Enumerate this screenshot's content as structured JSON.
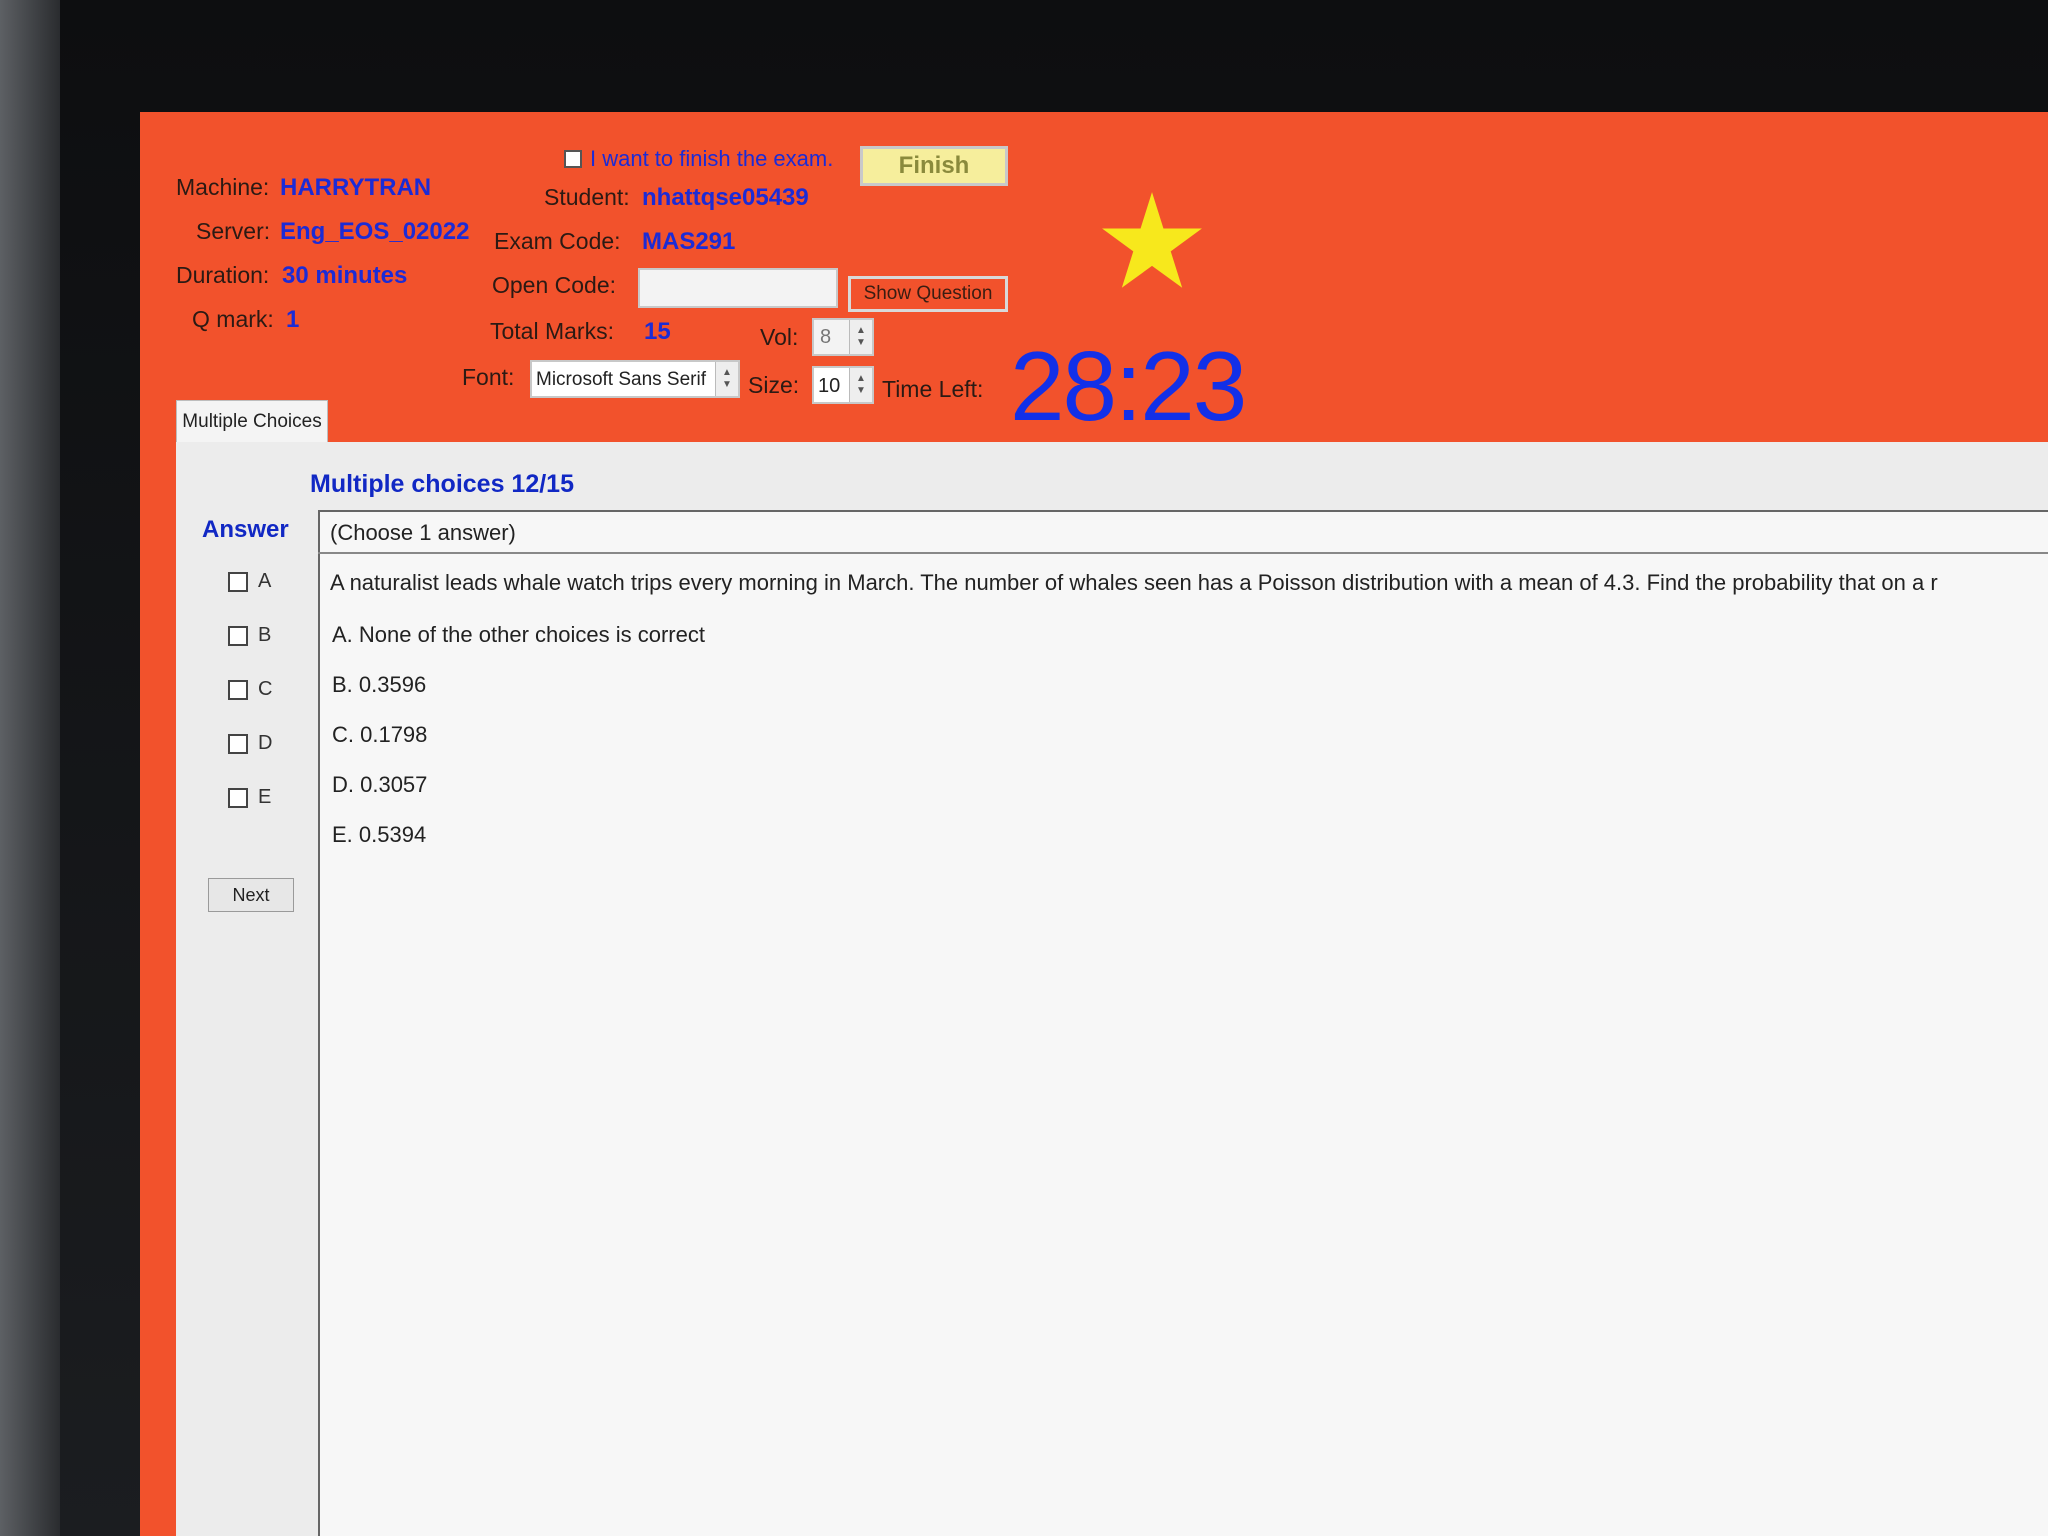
{
  "header": {
    "finish_checkbox_label": "I want to finish the exam.",
    "finish_button": "Finish",
    "machine": {
      "label": "Machine:",
      "value": "HARRYTRAN"
    },
    "server": {
      "label": "Server:",
      "value": "Eng_EOS_02022"
    },
    "duration": {
      "label": "Duration:",
      "value": "30 minutes"
    },
    "q_mark": {
      "label": "Q mark:",
      "value": "1"
    },
    "student": {
      "label": "Student:",
      "value": "nhattqse05439"
    },
    "exam_code": {
      "label": "Exam Code:",
      "value": "MAS291"
    },
    "open_code": {
      "label": "Open Code:",
      "value": ""
    },
    "show_question_button": "Show Question",
    "total_marks": {
      "label": "Total Marks:",
      "value": "15"
    },
    "vol": {
      "label": "Vol:",
      "value": "8"
    },
    "font": {
      "label": "Font:",
      "value": "Microsoft Sans Serif"
    },
    "size": {
      "label": "Size:",
      "value": "10"
    },
    "time_left": {
      "label": "Time Left:",
      "value": "28:23"
    },
    "star_color": "#f7e81c"
  },
  "tabs": [
    {
      "label": "Multiple Choices"
    }
  ],
  "question": {
    "title": "Multiple choices 12/15",
    "answer_label": "Answer",
    "instruction": "(Choose 1 answer)",
    "text": "A naturalist leads whale watch trips every morning in March. The number of whales seen has a Poisson distribution with a mean of  4.3. Find the probability that on a r",
    "options": [
      {
        "letter": "A",
        "text": "A. None of the other choices is correct"
      },
      {
        "letter": "B",
        "text": "B. 0.3596"
      },
      {
        "letter": "C",
        "text": "C. 0.1798"
      },
      {
        "letter": "D",
        "text": "D. 0.3057"
      },
      {
        "letter": "E",
        "text": "E. 0.5394"
      }
    ],
    "next_button": "Next"
  },
  "colors": {
    "background": "#f2522c",
    "value_blue": "#1c2bd6",
    "timer_blue": "#1230e8"
  }
}
